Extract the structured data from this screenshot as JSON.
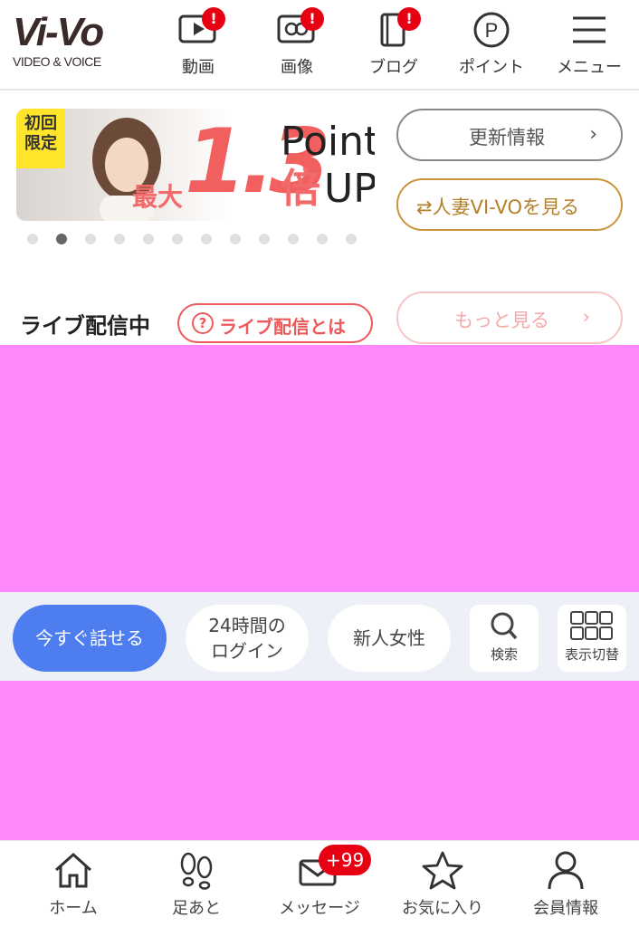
{
  "header": {
    "logo_main": "Vi-Vo",
    "logo_sub": "VIDEO & VOICE",
    "nav": [
      {
        "label": "動画",
        "icon": "video-play-icon",
        "badge": "!"
      },
      {
        "label": "画像",
        "icon": "image-icon",
        "badge": "!"
      },
      {
        "label": "ブログ",
        "icon": "blog-icon",
        "badge": "!"
      },
      {
        "label": "ポイント",
        "icon": "point-icon"
      },
      {
        "label": "メニュー",
        "icon": "hamburger-menu-icon"
      }
    ]
  },
  "banner": {
    "tag": "初回限定",
    "prefix": "最大",
    "multiplier": "1.3",
    "point": "Point",
    "bai": "倍",
    "up": "UP",
    "slide_count": 12,
    "active_slide": 2
  },
  "buttons": {
    "update": "更新情報",
    "hitozuma": "⇄人妻VI-VOを見る",
    "chevron": "›"
  },
  "live": {
    "title": "ライブ配信中",
    "what_label": "ライブ配信とは",
    "what_icon": "?",
    "more": "もっと見る",
    "chevron": "›"
  },
  "filters": {
    "chips": [
      {
        "label": "今すぐ話せる",
        "active": true
      },
      {
        "label": "24時間の\nログイン",
        "active": false
      },
      {
        "label": "新人女性",
        "active": false
      }
    ],
    "search": "検索",
    "view_toggle": "表示切替"
  },
  "tabbar": [
    {
      "label": "ホーム",
      "icon": "home-icon"
    },
    {
      "label": "足あと",
      "icon": "footprints-icon"
    },
    {
      "label": "メッセージ",
      "icon": "envelope-icon",
      "badge": "+99"
    },
    {
      "label": "お気に入り",
      "icon": "star-icon"
    },
    {
      "label": "会員情報",
      "icon": "user-icon"
    }
  ],
  "colors": {
    "placeholder": "#ff88fb",
    "accent_blue": "#4e7df0",
    "accent_red": "#e60012",
    "gold": "#c9953c"
  }
}
